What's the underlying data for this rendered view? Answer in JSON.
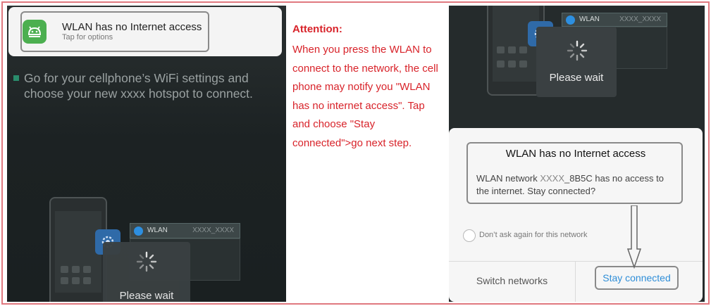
{
  "left_panel": {
    "notification": {
      "title": "WLAN has no Internet access",
      "subtitle": "Tap for options",
      "app_icon": "android-icon",
      "accent": "#4caf50"
    },
    "instruction": "Go for your cellphone’s WiFi settings and choose your new  xxxx  hotspot to connect.",
    "wlan_label": "WLAN",
    "wlan_ssid": "XXXX_XXXX",
    "wait_label": "Please wait"
  },
  "middle": {
    "heading": "Attention:",
    "body": "When you press the WLAN to connect to the network, the cell phone may notify you \"WLAN has no internet access\". Tap and choose \"Stay connected\">go next step.",
    "color": "#d8232a"
  },
  "right_panel": {
    "wlan_label": "WLAN",
    "wlan_ssid": "XXXX_XXXX",
    "wait_label": "Please wait",
    "dialog": {
      "title": "WLAN has no Internet access",
      "body_prefix": "WLAN network ",
      "body_ssid": "XXXX",
      "body_suffix": "_8B5C has no access to the internet. Stay connected?",
      "checkbox_label": "Don’t ask again for this network",
      "switch_button": "Switch networks",
      "stay_button": "Stay connected",
      "accent": "#2f8ed8"
    }
  }
}
